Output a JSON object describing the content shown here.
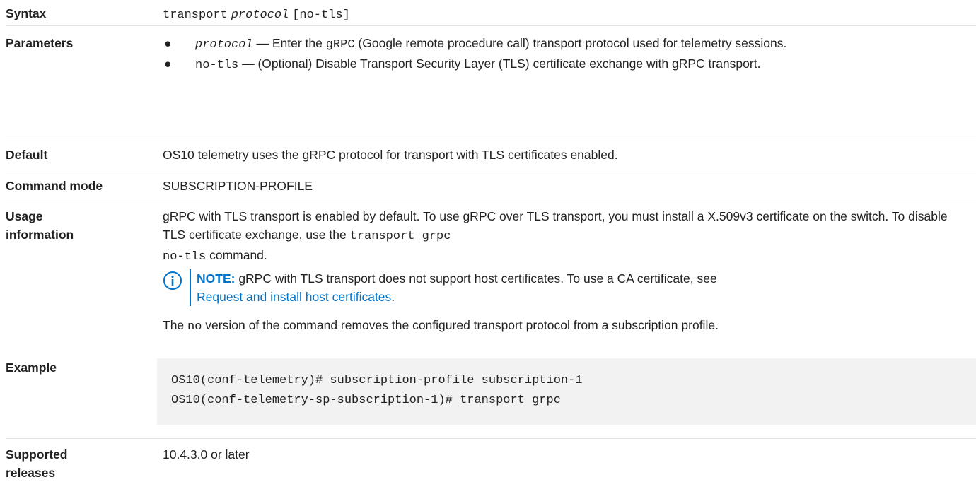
{
  "syntax": {
    "label": "Syntax",
    "cmd": "transport",
    "param": "protocol",
    "option": "[no-tls]"
  },
  "parameters": {
    "label": "Parameters",
    "items": [
      {
        "bullet": "●",
        "term": "protocol",
        "text_a": " — Enter the ",
        "code": "gRPC",
        "text_b": " (Google remote procedure call) transport protocol used for telemetry sessions."
      },
      {
        "bullet": "●",
        "term": "no-tls",
        "text_a": " — (Optional) Disable Transport Security Layer (TLS) certificate exchange with gRPC transport."
      }
    ]
  },
  "default": {
    "label": "Default",
    "text": "OS10 telemetry uses the gRPC protocol for transport with TLS certificates enabled."
  },
  "command_mode": {
    "label": "Command mode",
    "text": "SUBSCRIPTION-PROFILE"
  },
  "usage": {
    "label_line1": "Usage",
    "label_line2": "information",
    "text_a": "gRPC with TLS transport is enabled by default. To use gRPC over TLS transport, you must install a X.509v3 certificate on the switch. To disable TLS certificate exchange, use the ",
    "code1": "transport grpc",
    "code2": "no-tls",
    "text_b": " command.",
    "note_title": "NOTE:",
    "note_text": " gRPC with TLS transport does not support host certificates. To use a CA certificate, see ",
    "note_link": "Request and install host certificates",
    "note_end": ".",
    "no_a": "The ",
    "no_code": "no",
    "no_b": " version of the command removes the configured transport protocol from a subscription profile."
  },
  "example": {
    "label": "Example",
    "lines": [
      "OS10(conf-telemetry)# subscription-profile subscription-1",
      "OS10(conf-telemetry-sp-subscription-1)# transport grpc"
    ]
  },
  "supported": {
    "label_line1": "Supported",
    "label_line2": "releases",
    "text": "10.4.3.0 or later"
  },
  "colors": {
    "accent": "#0076ce",
    "code_background": "#f2f2f2",
    "divider": "#e2e2e2"
  }
}
